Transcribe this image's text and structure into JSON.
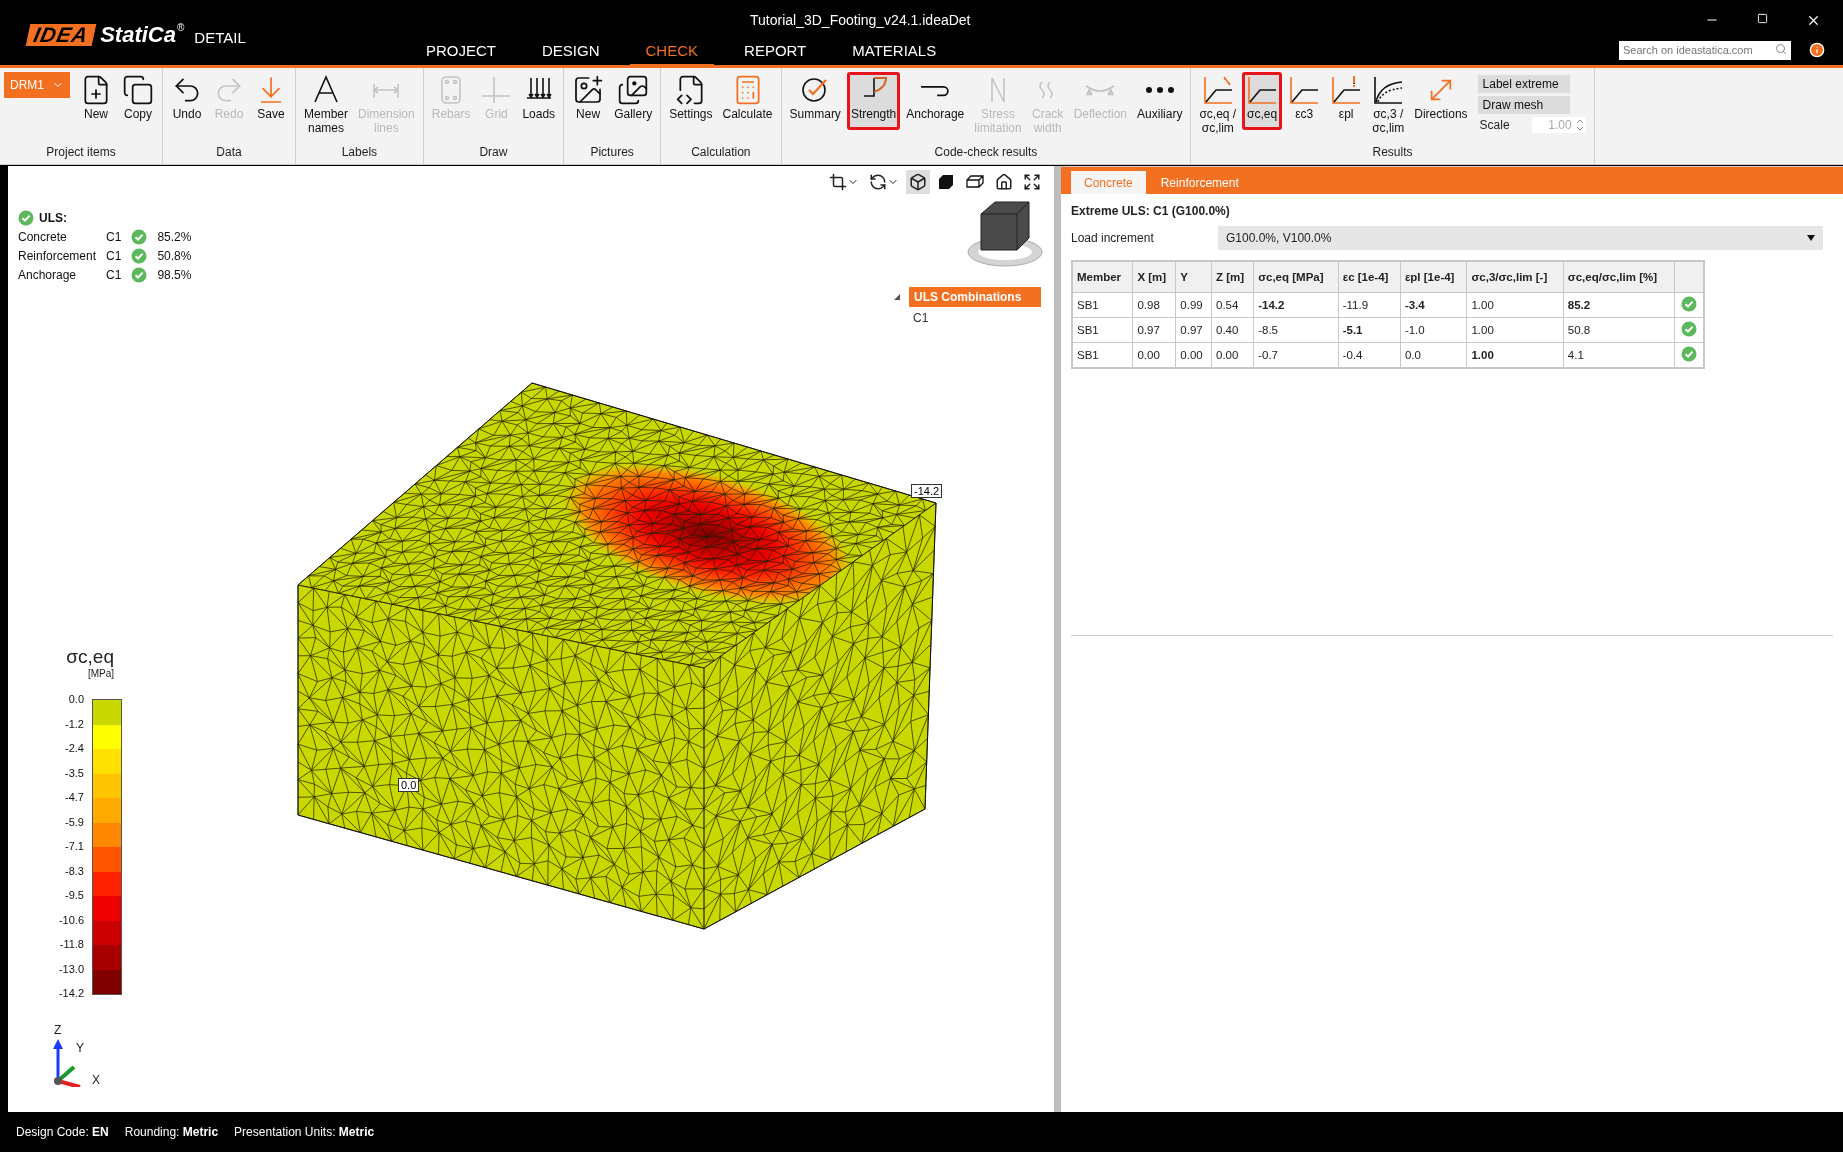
{
  "app": {
    "logo_mark": "IDEA",
    "logo_brand": "StatiCa",
    "logo_reg": "®",
    "logo_product": "DETAIL",
    "title": "Tutorial_3D_Footing_v24.1.ideaDet"
  },
  "menu_tabs": [
    {
      "label": "PROJECT",
      "selected": false
    },
    {
      "label": "DESIGN",
      "selected": false
    },
    {
      "label": "CHECK",
      "selected": true
    },
    {
      "label": "REPORT",
      "selected": false
    },
    {
      "label": "MATERIALS",
      "selected": false
    }
  ],
  "search": {
    "placeholder": "Search on ideastatica.com"
  },
  "ribbon": [
    {
      "label": "Project items",
      "items": [
        {
          "kind": "dropdown",
          "label": "DRM1"
        },
        {
          "kind": "button",
          "label": "New",
          "disabled": false,
          "selected": false
        },
        {
          "kind": "button",
          "label": "Copy",
          "disabled": false,
          "selected": false
        }
      ]
    },
    {
      "label": "Data",
      "items": [
        {
          "kind": "button",
          "label": "Undo",
          "disabled": false,
          "selected": false
        },
        {
          "kind": "button",
          "label": "Redo",
          "disabled": true,
          "selected": false
        },
        {
          "kind": "button",
          "label": "Save",
          "disabled": false,
          "selected": false
        }
      ]
    },
    {
      "label": "Labels",
      "items": [
        {
          "kind": "button",
          "label": "Member\nnames",
          "disabled": false,
          "selected": false
        },
        {
          "kind": "button",
          "label": "Dimension\nlines",
          "disabled": true,
          "selected": false
        }
      ]
    },
    {
      "label": "Draw",
      "items": [
        {
          "kind": "button",
          "label": "Rebars",
          "disabled": true,
          "selected": false
        },
        {
          "kind": "button",
          "label": "Grid",
          "disabled": true,
          "selected": false
        },
        {
          "kind": "button",
          "label": "Loads",
          "disabled": false,
          "selected": false
        }
      ]
    },
    {
      "label": "Pictures",
      "items": [
        {
          "kind": "button",
          "label": "New",
          "disabled": false,
          "selected": false
        },
        {
          "kind": "button",
          "label": "Gallery",
          "disabled": false,
          "selected": false
        }
      ]
    },
    {
      "label": "Calculation",
      "items": [
        {
          "kind": "button",
          "label": "Settings",
          "disabled": false,
          "selected": false
        },
        {
          "kind": "button",
          "label": "Calculate",
          "disabled": false,
          "selected": false
        }
      ]
    },
    {
      "label": "Code-check results",
      "items": [
        {
          "kind": "button",
          "label": "Summary",
          "disabled": false,
          "selected": false
        },
        {
          "kind": "button",
          "label": "Strength",
          "disabled": false,
          "selected": true
        },
        {
          "kind": "button",
          "label": "Anchorage",
          "disabled": false,
          "selected": false
        },
        {
          "kind": "button",
          "label": "Stress\nlimitation",
          "disabled": true,
          "selected": false
        },
        {
          "kind": "button",
          "label": "Crack\nwidth",
          "disabled": true,
          "selected": false
        },
        {
          "kind": "button",
          "label": "Deflection",
          "disabled": true,
          "selected": false
        },
        {
          "kind": "button",
          "label": "Auxiliary",
          "disabled": false,
          "selected": false
        }
      ]
    },
    {
      "label": "Results",
      "items": [
        {
          "kind": "button",
          "label": "σc,eq /\nσc,lim",
          "disabled": false,
          "selected": false
        },
        {
          "kind": "button",
          "label": "σc,eq",
          "disabled": false,
          "selected": true
        },
        {
          "kind": "button",
          "label": "εc3",
          "disabled": false,
          "selected": false
        },
        {
          "kind": "button",
          "label": "εpl",
          "disabled": false,
          "selected": false
        },
        {
          "kind": "button",
          "label": "σc,3 /\nσc,lim",
          "disabled": false,
          "selected": false
        },
        {
          "kind": "button",
          "label": "Directions",
          "disabled": false,
          "selected": false
        },
        {
          "kind": "toggle",
          "label": "Label extreme",
          "selected": true
        },
        {
          "kind": "toggle",
          "label": "Draw mesh",
          "selected": true
        },
        {
          "kind": "spin",
          "label": "Scale",
          "value": "1.00",
          "disabled": true
        }
      ]
    }
  ],
  "view_tools": [
    {
      "selected": false
    },
    {
      "selected": false
    },
    {
      "selected": true
    },
    {
      "selected": false
    },
    {
      "selected": false
    },
    {
      "selected": false
    },
    {
      "selected": false
    }
  ],
  "summary": {
    "title": "ULS:",
    "passed": true,
    "rows": [
      {
        "name": "Concrete",
        "combo": "C1",
        "passed": true,
        "value": "85.2%"
      },
      {
        "name": "Reinforcement",
        "combo": "C1",
        "passed": true,
        "value": "50.8%"
      },
      {
        "name": "Anchorage",
        "combo": "C1",
        "passed": true,
        "value": "98.5%"
      }
    ]
  },
  "combinations": {
    "label": "ULS Combinations",
    "expanded": true,
    "selected": true,
    "children": [
      {
        "label": "C1",
        "selected": false
      }
    ]
  },
  "model_labels": {
    "max": "-14.2",
    "min": "0.0"
  },
  "legend": {
    "title": "σc,eq",
    "unit": "[MPa]",
    "ticks": [
      "0.0",
      "-1.2",
      "-2.4",
      "-3.5",
      "-4.7",
      "-5.9",
      "-7.1",
      "-8.3",
      "-9.5",
      "-10.6",
      "-11.8",
      "-13.0",
      "-14.2"
    ],
    "bands": [
      {
        "color": "#c8d800"
      },
      {
        "color": "#ffff00"
      },
      {
        "color": "#ffe000"
      },
      {
        "color": "#ffc400"
      },
      {
        "color": "#ffaa00"
      },
      {
        "color": "#ff8800"
      },
      {
        "color": "#ff5500"
      },
      {
        "color": "#ff2200"
      },
      {
        "color": "#ee0000"
      },
      {
        "color": "#cc0000"
      },
      {
        "color": "#a80000"
      },
      {
        "color": "#800000"
      }
    ]
  },
  "axes": {
    "z": "Z",
    "y": "Y",
    "x": "X"
  },
  "panel": {
    "tabs": [
      {
        "label": "Concrete",
        "selected": true
      },
      {
        "label": "Reinforcement",
        "selected": false
      }
    ],
    "heading": "Extreme ULS: C1 (G100.0%)",
    "load_increment": {
      "label": "Load increment",
      "value": "G100.0%, V100.0%"
    },
    "table": {
      "columns": [
        "Member",
        "X [m]",
        "Y",
        "Z [m]",
        "σc,eq [MPa]",
        "εc [1e-4]",
        "εpl [1e-4]",
        "σc,3/σc,lim [-]",
        "σc,eq/σc,lim [%]"
      ],
      "rows": [
        {
          "passed": true,
          "cells": [
            {
              "text": "SB1",
              "bold": false
            },
            {
              "text": "0.98",
              "bold": false
            },
            {
              "text": "0.99",
              "bold": false
            },
            {
              "text": "0.54",
              "bold": false
            },
            {
              "text": "-14.2",
              "bold": true
            },
            {
              "text": "-11.9",
              "bold": false
            },
            {
              "text": "-3.4",
              "bold": true
            },
            {
              "text": "1.00",
              "bold": false
            },
            {
              "text": "85.2",
              "bold": true
            }
          ]
        },
        {
          "passed": true,
          "cells": [
            {
              "text": "SB1",
              "bold": false
            },
            {
              "text": "0.97",
              "bold": false
            },
            {
              "text": "0.97",
              "bold": false
            },
            {
              "text": "0.40",
              "bold": false
            },
            {
              "text": "-8.5",
              "bold": false
            },
            {
              "text": "-5.1",
              "bold": true
            },
            {
              "text": "-1.0",
              "bold": false
            },
            {
              "text": "1.00",
              "bold": false
            },
            {
              "text": "50.8",
              "bold": false
            }
          ]
        },
        {
          "passed": true,
          "cells": [
            {
              "text": "SB1",
              "bold": false
            },
            {
              "text": "0.00",
              "bold": false
            },
            {
              "text": "0.00",
              "bold": false
            },
            {
              "text": "0.00",
              "bold": false
            },
            {
              "text": "-0.7",
              "bold": false
            },
            {
              "text": "-0.4",
              "bold": false
            },
            {
              "text": "0.0",
              "bold": false
            },
            {
              "text": "1.00",
              "bold": true
            },
            {
              "text": "4.1",
              "bold": false
            }
          ]
        }
      ]
    }
  },
  "status_bar": [
    "Design Code: **EN**",
    "Rounding: **Metric**",
    "Presentation Units: **Metric**"
  ]
}
